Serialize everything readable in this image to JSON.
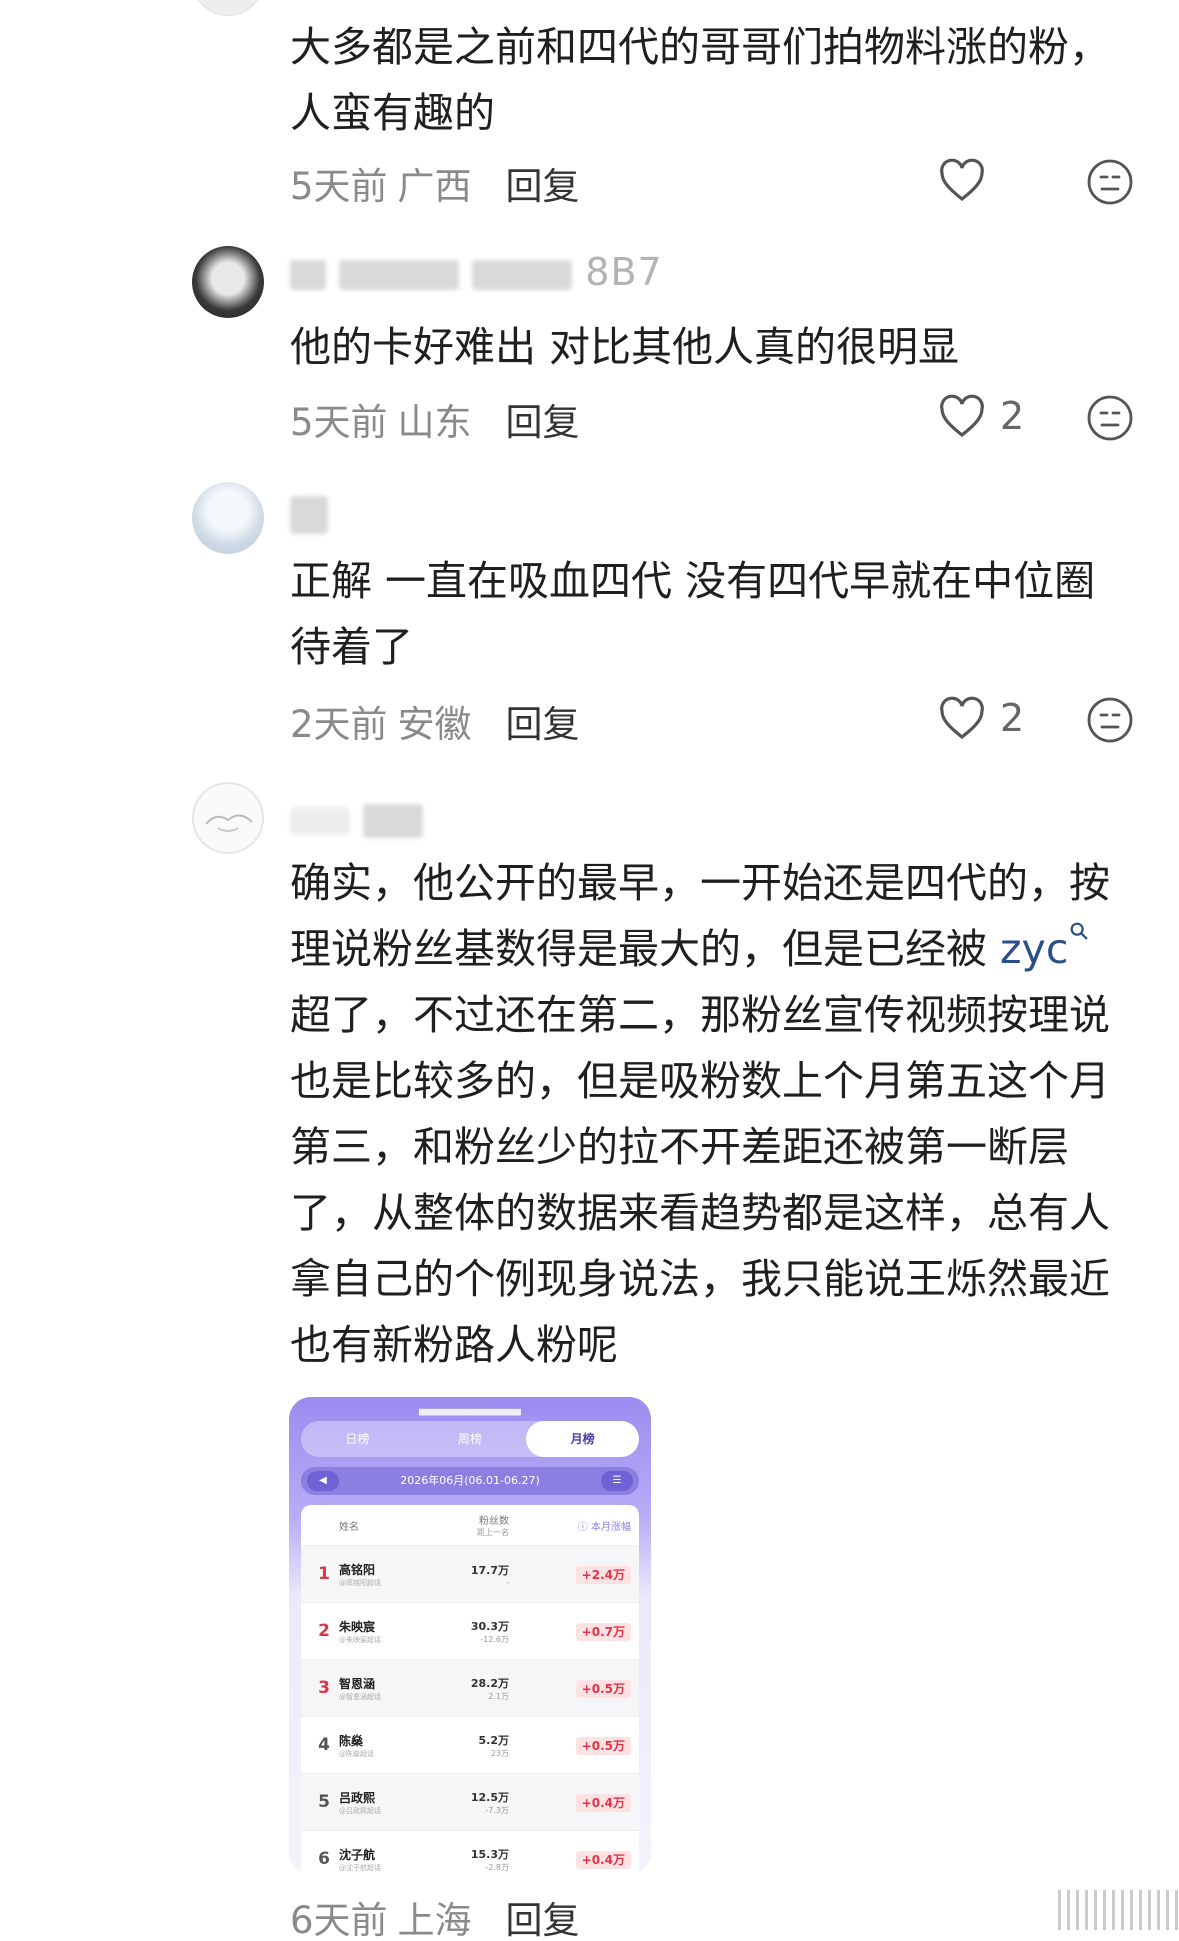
{
  "comments": [
    {
      "text": "大多都是之前和四代的哥哥们拍物料涨的粉，人蛮有趣的",
      "time": "5天前",
      "location": "广西",
      "reply_label": "回复",
      "likes": ""
    },
    {
      "username_visible": "8B7",
      "text": "他的卡好难出  对比其他人真的很明显",
      "time": "5天前",
      "location": "山东",
      "reply_label": "回复",
      "likes": "2"
    },
    {
      "text": "正解 一直在吸血四代 没有四代早就在中位圈待着了",
      "time": "2天前",
      "location": "安徽",
      "reply_label": "回复",
      "likes": "2"
    },
    {
      "text_before_link": "确实，他公开的最早，一开始还是四代的，按理说粉丝基数得是最大的，但是已经被 ",
      "link_text": "zyc",
      "text_after_link": "超了，不过还在第二，那粉丝宣传视频按理说也是比较多的，但是吸粉数上个月第五这个月第三，和粉丝少的拉不开差距还被第一断层了，从整体的数据来看趋势都是这样，总有人拿自己的个例现身说法，我只能说王烁然最近也有新粉路人粉呢",
      "time": "6天前",
      "location": "上海",
      "reply_label": "回复"
    }
  ],
  "embedded_ranking": {
    "tabs": [
      "日榜",
      "周榜",
      "月榜"
    ],
    "active_tab": "月榜",
    "date_range": "2026年06月(06.01-06.27)",
    "headers": {
      "name": "姓名",
      "fans": "粉丝数",
      "fans_sub": "距上一名",
      "gain": "ⓘ 本月涨幅"
    },
    "rows": [
      {
        "rank": "1",
        "name": "高铭阳",
        "sub": "@高铭阳超话",
        "fans": "17.7万",
        "gap": "-",
        "gain": "+2.4万"
      },
      {
        "rank": "2",
        "name": "朱映宸",
        "sub": "@朱映宸超话",
        "fans": "30.3万",
        "gap": "-12.6万",
        "gain": "+0.7万"
      },
      {
        "rank": "3",
        "name": "智恩涵",
        "sub": "@智恩涵超话",
        "fans": "28.2万",
        "gap": "2.1万",
        "gain": "+0.5万"
      },
      {
        "rank": "4",
        "name": "陈燊",
        "sub": "@陈燊超话",
        "fans": "5.2万",
        "gap": "23万",
        "gain": "+0.5万"
      },
      {
        "rank": "5",
        "name": "吕政熙",
        "sub": "@吕政熙超话",
        "fans": "12.5万",
        "gap": "-7.3万",
        "gain": "+0.4万"
      },
      {
        "rank": "6",
        "name": "沈子航",
        "sub": "@沈子航超话",
        "fans": "15.3万",
        "gap": "-2.8万",
        "gain": "+0.4万"
      }
    ]
  },
  "icons": {
    "like": "heart-icon",
    "dislike": "meh-face-icon"
  }
}
